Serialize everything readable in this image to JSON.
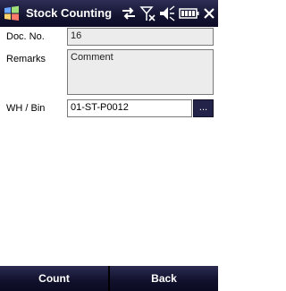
{
  "titlebar": {
    "title": "Stock Counting",
    "start_icon": "windows-flag-icon",
    "status_icons": [
      "connectivity-icon",
      "signal-off-icon",
      "speaker-muted-icon",
      "battery-icon"
    ]
  },
  "form": {
    "doc_no_label": "Doc. No.",
    "doc_no_value": "16",
    "remarks_label": "Remarks",
    "remarks_value": "Comment",
    "wh_bin_label": "WH / Bin",
    "wh_bin_value": "01-ST-P0012",
    "browse_label": "..."
  },
  "menubar": {
    "left_label": "Count",
    "right_label": "Back"
  },
  "colors": {
    "bar_background": "#141432",
    "field_readonly": "#ececec",
    "field_editable": "#ffffff"
  }
}
